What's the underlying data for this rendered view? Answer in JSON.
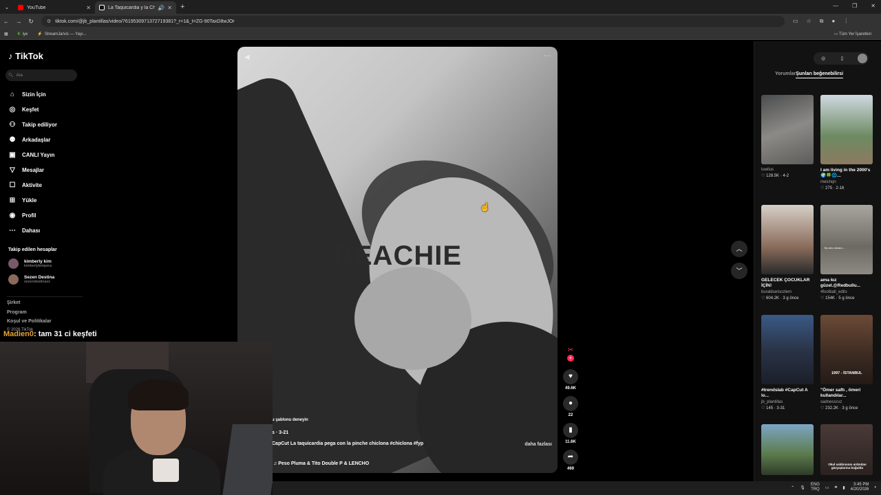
{
  "browser": {
    "tabs": [
      {
        "title": "YouTube",
        "active": false,
        "icon_color": "#ff0000"
      },
      {
        "title": "La Taquicardia y la Chiclona",
        "active": true,
        "icon_color": "#ffffff"
      }
    ],
    "url": "tiktok.com/@jb_plantillas/video/7619530971372719381?_r=1&_t=ZG-90TaxD8wJOr",
    "bookmarks": [
      "iye",
      "StreamJarvis — Yayı..."
    ],
    "bookmarks_right": "Tüm Yer İşaretleri"
  },
  "sidebar": {
    "logo": "TikTok",
    "search_placeholder": "Ara",
    "nav": [
      {
        "label": "Sizin İçin",
        "icon": "home-icon"
      },
      {
        "label": "Keşfet",
        "icon": "compass-icon"
      },
      {
        "label": "Takip ediliyor",
        "icon": "following-icon"
      },
      {
        "label": "Arkadaşlar",
        "icon": "friends-icon"
      },
      {
        "label": "CANLI Yayın",
        "icon": "live-icon"
      },
      {
        "label": "Mesajlar",
        "icon": "messages-icon"
      },
      {
        "label": "Aktivite",
        "icon": "activity-icon"
      },
      {
        "label": "Yükle",
        "icon": "upload-icon"
      },
      {
        "label": "Profil",
        "icon": "profile-icon"
      },
      {
        "label": "Dahası",
        "icon": "more-icon"
      }
    ],
    "followed_title": "Takip edilen hesaplar",
    "followed": [
      {
        "name": "kimberly kim",
        "handle": "kimberlykimpera"
      },
      {
        "name": "Sezen Destina",
        "handle": "sezendestinaxx"
      }
    ],
    "footer": [
      "Şirket",
      "Program",
      "Koşul ve Politikalar",
      "© 2026 TikTok"
    ]
  },
  "video": {
    "overlay_text": "BEACHIE",
    "template_line": "u şablonu deneyin",
    "date_line": "s · 3-21",
    "caption": "CapCut La taquicardia pega con la pinche chiclona #chiclona #fyp",
    "more_label": "daha fazlası",
    "music": "Peso Pluma & Tito Double P & LENCHO"
  },
  "actions": {
    "likes": "49.6K",
    "comments": "22",
    "saves": "11.6K",
    "shares": "469"
  },
  "right_panel": {
    "tabs": [
      "Yorumlar",
      "Şunları beğenebilirsi"
    ],
    "active_tab": 1,
    "cards": [
      {
        "title": "",
        "user": "luwilus",
        "stats": "♡ 128.5K · 4-2",
        "color": "#6b6e70"
      },
      {
        "title": "I am living in the 2000's🌍🍀🌐...",
        "user": "meichqn",
        "stats": "♡ 275 · 2-16",
        "color": "#7f8f6a"
      },
      {
        "title": "GELECEK ÇOCUKLAR İÇİN!",
        "user": "burakbarisozlem",
        "stats": "♡ 604.2K · 3 g önce",
        "color": "#9c8878"
      },
      {
        "title": "ama kız güzel.@Redbullu...",
        "user": "4football_edits",
        "stats": "♡ 154K · 5 g önce",
        "color": "#8b8478"
      },
      {
        "title": "#trendslab #CapCut A lo...",
        "user": "jb_plantillas",
        "stats": "♡ 145 · 3-31",
        "color": "#36445e"
      },
      {
        "title": "\"Ömer saftı , ömeri kullandılar...",
        "user": "sadnesscvz",
        "stats": "♡ 232.2K · 3 g önce",
        "color": "#5a4132"
      },
      {
        "title": "",
        "user": "",
        "stats": "",
        "color": "#6f8ca0"
      },
      {
        "title": "",
        "user": "",
        "stats": "",
        "color": "#3a2e2c"
      }
    ],
    "thumb_texts": [
      "",
      "",
      "",
      "Bu ses ormanı...",
      "",
      "1997 - İSTANBUL",
      "",
      "Okul saldırısının ardından gözyaşlarına boğuldu"
    ]
  },
  "stream": {
    "chat_user": "Madien0",
    "chat_text": ": tam 31 ci keşfeti"
  },
  "taskbar": {
    "lang_top": "ENG",
    "lang_bottom": "TRQ",
    "time": "3:45 PM",
    "date": "4/20/2026"
  }
}
